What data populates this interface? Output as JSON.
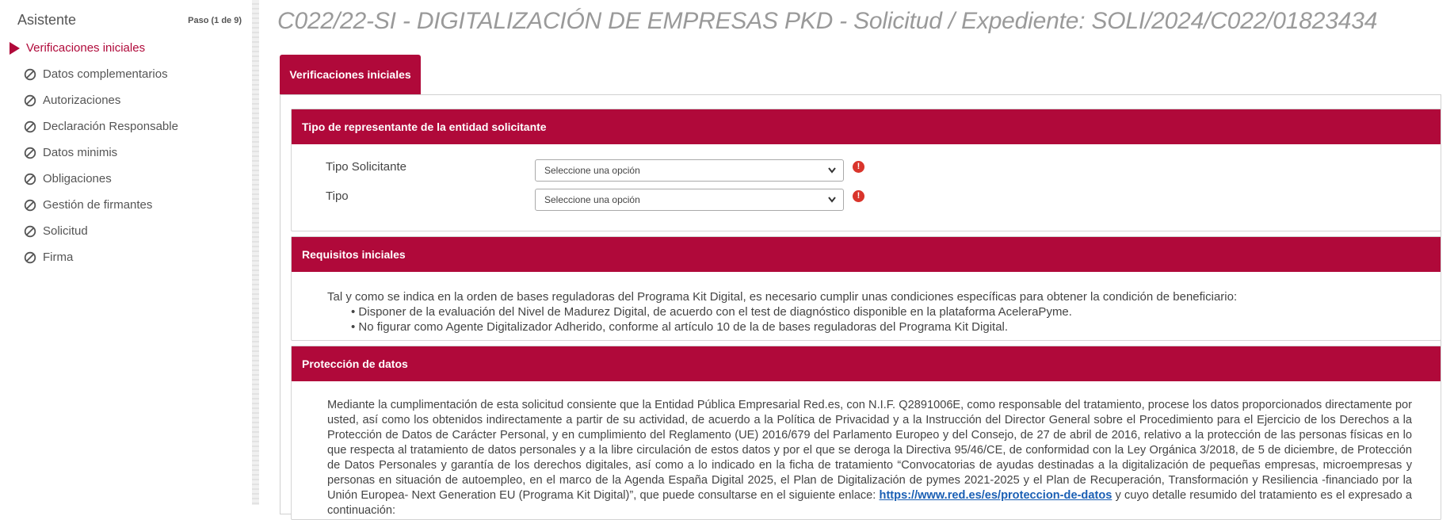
{
  "sidebar": {
    "title": "Asistente",
    "step": "Paso (1 de 9)",
    "items": [
      {
        "label": "Verificaciones iniciales",
        "active": true
      },
      {
        "label": "Datos complementarios"
      },
      {
        "label": "Autorizaciones"
      },
      {
        "label": "Declaración Responsable"
      },
      {
        "label": "Datos minimis"
      },
      {
        "label": "Obligaciones"
      },
      {
        "label": "Gestión de firmantes"
      },
      {
        "label": "Solicitud"
      },
      {
        "label": "Firma"
      }
    ]
  },
  "header": {
    "title": "C022/22-SI - DIGITALIZACIÓN DE EMPRESAS PKD - Solicitud / Expediente: SOLI/2024/C022/01823434"
  },
  "tabs": [
    {
      "label": "Verificaciones iniciales"
    }
  ],
  "sections": {
    "representante": {
      "title": "Tipo de representante de la entidad solicitante",
      "fields": [
        {
          "label": "Tipo Solicitante",
          "value": "Seleccione una opción"
        },
        {
          "label": "Tipo",
          "value": "Seleccione una opción"
        }
      ]
    },
    "requisitos": {
      "title": "Requisitos iniciales",
      "intro": "Tal y como se indica en la orden de bases reguladoras del Programa Kit Digital, es necesario cumplir unas condiciones específicas para obtener la condición de beneficiario:",
      "bullets": [
        "• Disponer de la evaluación del Nivel de Madurez Digital, de acuerdo con el test de diagnóstico disponible en la plataforma AceleraPyme.",
        "• No figurar como Agente Digitalizador Adherido, conforme al artículo 10 de la de bases reguladoras del Programa Kit Digital."
      ]
    },
    "proteccion": {
      "title": "Protección de datos",
      "text_before": "Mediante la cumplimentación de esta solicitud consiente que la Entidad Pública Empresarial Red.es, con N.I.F. Q2891006E, como responsable del tratamiento, procese los datos proporcionados directamente por usted, así como los obtenidos indirectamente a partir de su actividad, de acuerdo a la Política de Privacidad y a la Instrucción del Director General sobre el Procedimiento para el Ejercicio de los Derechos a la Protección de Datos de Carácter Personal, y en cumplimiento del Reglamento (UE) 2016/679 del Parlamento Europeo y del Consejo, de 27 de abril de 2016, relativo a la protección de las personas físicas en lo que respecta al tratamiento de datos personales y a la libre circulación de estos datos y por el que se deroga la Directiva 95/46/CE, de conformidad con la Ley Orgánica 3/2018, de 5 de diciembre, de Protección de Datos Personales y garantía de los derechos digitales, así como a lo indicado en la ficha de tratamiento “Convocatorias de ayudas destinadas a la digitalización de pequeñas empresas, microempresas y personas en situación de autoempleo, en el marco de la Agenda España Digital 2025, el Plan de Digitalización de pymes 2021-2025 y el Plan de Recuperación, Transformación y Resiliencia -financiado por la Unión Europea- Next Generation EU (Programa Kit Digital)”, que puede consultarse en el siguiente enlace: ",
      "link": "https://www.red.es/es/proteccion-de-datos",
      "text_after": " y cuyo detalle resumido del tratamiento es el expresado a continuación:"
    }
  },
  "colors": {
    "brand": "#b0093a",
    "alert": "#d9342b",
    "link": "#1a5fb4"
  },
  "icons": {
    "active_marker": "triangle-right-icon",
    "pending_marker": "ban-icon",
    "field_alert": "exclamation-circle-icon",
    "select_caret": "chevron-down-icon"
  }
}
